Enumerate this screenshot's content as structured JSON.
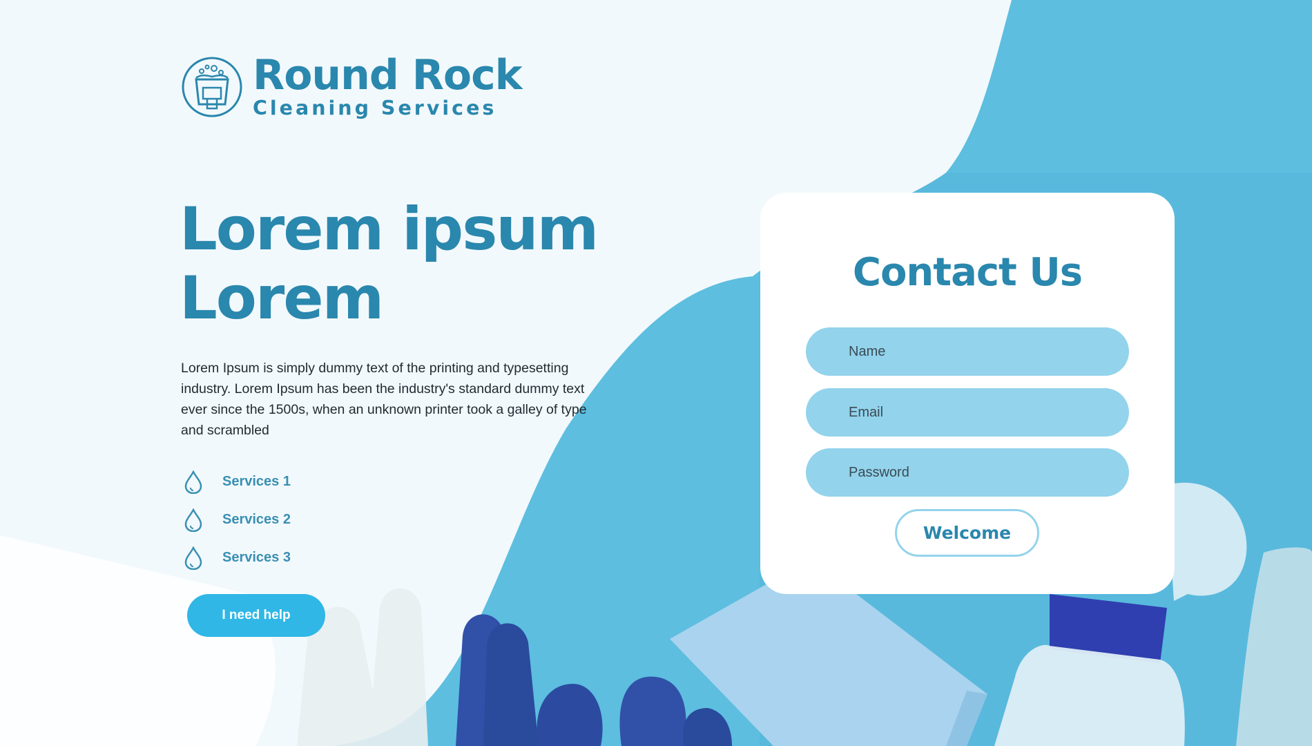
{
  "brand": {
    "name": "Round Rock",
    "subtitle": "Cleaning Services"
  },
  "hero": {
    "title_line1": "Lorem ipsum",
    "title_line2": "Lorem",
    "description": "Lorem Ipsum is simply dummy text of the printing and typesetting industry. Lorem Ipsum has been the industry's standard dummy text ever since the 1500s, when an unknown printer took a galley of type and scrambled"
  },
  "services": {
    "icon": "water-drop-icon",
    "items": [
      {
        "label": "Services 1"
      },
      {
        "label": "Services 2"
      },
      {
        "label": "Services 3"
      }
    ]
  },
  "help_button": {
    "label": "I need help"
  },
  "contact": {
    "title": "Contact Us",
    "name_placeholder": "Name",
    "email_placeholder": "Email",
    "password_placeholder": "Password",
    "submit_label": "Welcome"
  },
  "colors": {
    "brand": "#2a87ad",
    "accent": "#30b7e6",
    "field": "#93d3ec",
    "background_light": "#f2f9fc",
    "background_blue": "#62c0e0"
  }
}
